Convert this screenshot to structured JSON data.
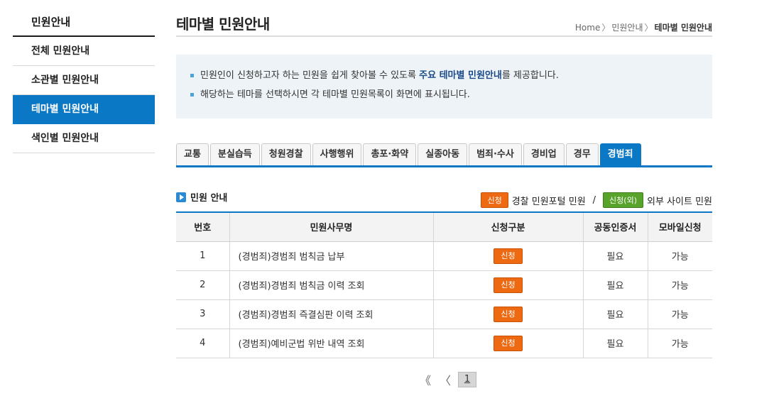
{
  "sidebar": {
    "title": "민원안내",
    "items": [
      {
        "label": "전체 민원안내"
      },
      {
        "label": "소관별 민원안내"
      },
      {
        "label": "테마별 민원안내"
      },
      {
        "label": "색인별 민원안내"
      }
    ]
  },
  "header": {
    "title": "테마별 민원안내",
    "breadcrumb": [
      "Home",
      "민원안내",
      "테마별 민원안내"
    ],
    "breadcrumb_sep": "〉"
  },
  "info": {
    "line1_pre": "민원인이 신청하고자 하는 민원을 쉽게 찾아볼 수 있도록 ",
    "line1_bold": "주요 테마별 민원안내",
    "line1_post": "를 제공합니다.",
    "line2": "해당하는 테마를 선택하시면 각 테마별 민원목록이 화면에 표시됩니다."
  },
  "tabs": [
    {
      "label": "교통"
    },
    {
      "label": "분실습득"
    },
    {
      "label": "청원경찰"
    },
    {
      "label": "사행행위"
    },
    {
      "label": "총포·화약"
    },
    {
      "label": "실종아동"
    },
    {
      "label": "범죄·수사"
    },
    {
      "label": "경비업"
    },
    {
      "label": "경무"
    },
    {
      "label": "경범죄"
    }
  ],
  "active_tab": "경범죄",
  "section": {
    "title": "민원 안내",
    "legend": {
      "badge1": "신청",
      "text1": "경찰 민원포털 민원",
      "slash": "/",
      "badge2": "신청(외)",
      "text2": "외부 사이트 민원"
    }
  },
  "table": {
    "headers": [
      "번호",
      "민원사무명",
      "신청구분",
      "공동인증서",
      "모바일신청"
    ],
    "rows": [
      {
        "no": "1",
        "name": "(경범죄)경범죄 범칙금 납부",
        "apply": "신청",
        "cert": "필요",
        "mobile": "가능"
      },
      {
        "no": "2",
        "name": "(경범죄)경범죄 범칙금 이력 조회",
        "apply": "신청",
        "cert": "필요",
        "mobile": "가능"
      },
      {
        "no": "3",
        "name": "(경범죄)경범죄 즉결심판 이력 조회",
        "apply": "신청",
        "cert": "필요",
        "mobile": "가능"
      },
      {
        "no": "4",
        "name": "(경범죄)예비군법 위반 내역 조회",
        "apply": "신청",
        "cert": "필요",
        "mobile": "가능"
      }
    ]
  },
  "pagination": {
    "first": "《",
    "prev": "〈",
    "current": "1"
  },
  "colors": {
    "accent": "#0b78c5",
    "apply_orange": "#ee6a12",
    "external_green": "#58a32a",
    "info_bg": "#edf3f6"
  }
}
